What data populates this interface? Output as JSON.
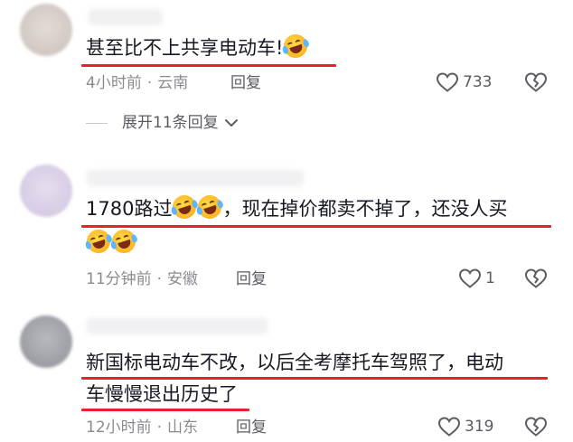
{
  "comments": [
    {
      "text_lines": [
        "甚至比不上共享电动车!"
      ],
      "emoji_count_line1": 1,
      "time": "4小时前",
      "location": "云南",
      "reply_label": "回复",
      "likes": "733",
      "avatar_color": "#d8d0cc",
      "expand_replies": "展开11条回复"
    },
    {
      "text_lines": [
        "1780路过",
        "，现在掉价都卖不掉了，还没人买"
      ],
      "time": "11分钟前",
      "location": "安徽",
      "reply_label": "回复",
      "likes": "1",
      "avatar_color": "#dcd3e8"
    },
    {
      "text_lines": [
        "新国标电动车不改，以后全考摩托车驾照了，电动",
        "车慢慢退出历史了"
      ],
      "time": "12小时前",
      "location": "山东",
      "reply_label": "回复",
      "likes": "319",
      "avatar_color": "#a3a5aa"
    }
  ],
  "separator": "·",
  "emoji_name": "laughing-crying-emoji",
  "accent_underline_color": "#e5232f"
}
